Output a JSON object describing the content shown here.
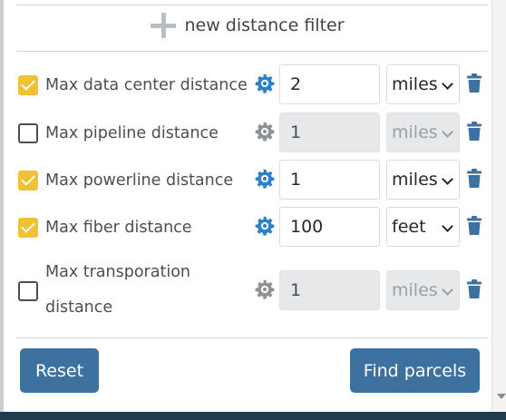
{
  "new_filter": {
    "label": "new distance filter"
  },
  "filters": [
    {
      "label_lines": [
        "Max data center distance"
      ],
      "checked": true,
      "enabled": true,
      "value": "2",
      "unit": "miles"
    },
    {
      "label_lines": [
        "Max pipeline distance"
      ],
      "checked": false,
      "enabled": false,
      "value": "1",
      "unit": "miles"
    },
    {
      "label_lines": [
        "Max powerline distance"
      ],
      "checked": true,
      "enabled": true,
      "value": "1",
      "unit": "miles"
    },
    {
      "label_lines": [
        "Max fiber distance"
      ],
      "checked": true,
      "enabled": true,
      "value": "100",
      "unit": "feet"
    },
    {
      "label_lines": [
        "Max transporation",
        "distance"
      ],
      "checked": false,
      "enabled": false,
      "value": "1",
      "unit": "miles"
    }
  ],
  "buttons": {
    "reset": "Reset",
    "find": "Find parcels"
  },
  "icons": {
    "settings": "gear-icon",
    "delete": "trash-icon",
    "add": "plus-icon",
    "dropdown": "chevron-down-icon"
  },
  "colors": {
    "accent": "#3d72a0",
    "checkbox_checked": "#f2c133",
    "icon_active": "#2f80c9",
    "icon_disabled": "#8d9296",
    "trash": "#3d72a0",
    "disabled_field": "#e7e8e9"
  }
}
